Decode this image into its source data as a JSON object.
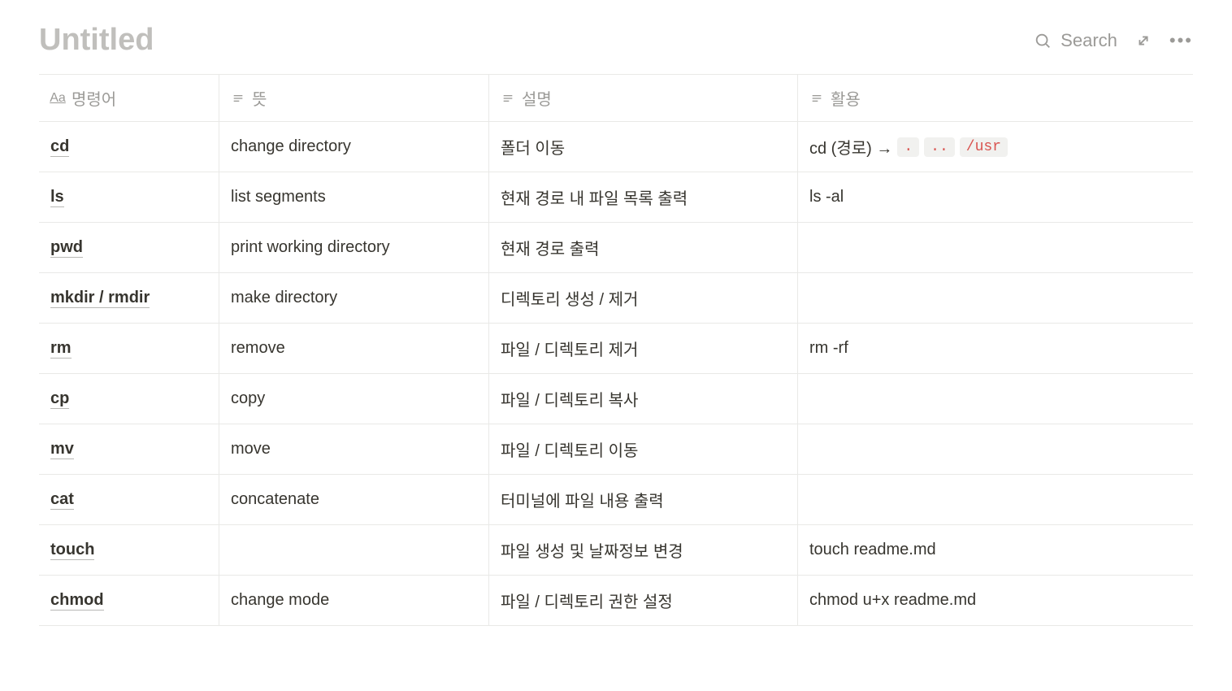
{
  "header": {
    "title": "Untitled",
    "search_label": "Search"
  },
  "table": {
    "columns": [
      {
        "label": "명령어",
        "icon": "aa"
      },
      {
        "label": "뜻",
        "icon": "lines"
      },
      {
        "label": "설명",
        "icon": "lines"
      },
      {
        "label": "활용",
        "icon": "lines"
      }
    ],
    "rows": [
      {
        "command": "cd",
        "meaning": "change directory",
        "description": "폴더 이동",
        "usage_prefix": "cd (경로) → ",
        "usage_chips": [
          ".",
          "..",
          "/usr"
        ]
      },
      {
        "command": "ls",
        "meaning": "list segments",
        "description": "현재 경로 내 파일 목록 출력",
        "usage_text": "ls -al"
      },
      {
        "command": "pwd",
        "meaning": "print working directory",
        "description": "현재 경로 출력",
        "usage_text": ""
      },
      {
        "command": "mkdir / rmdir",
        "meaning": "make directory",
        "description": "디렉토리 생성 / 제거",
        "usage_text": ""
      },
      {
        "command": "rm",
        "meaning": "remove",
        "description": "파일 / 디렉토리 제거",
        "usage_text": "rm -rf"
      },
      {
        "command": "cp",
        "meaning": "copy",
        "description": "파일 / 디렉토리 복사",
        "usage_text": ""
      },
      {
        "command": "mv",
        "meaning": "move",
        "description": "파일 / 디렉토리 이동",
        "usage_text": ""
      },
      {
        "command": "cat",
        "meaning": "concatenate",
        "description": "터미널에 파일 내용 출력",
        "usage_text": ""
      },
      {
        "command": "touch",
        "meaning": "",
        "description": "파일 생성 및 날짜정보 변경",
        "usage_text": "touch readme.md"
      },
      {
        "command": "chmod",
        "meaning": "change mode",
        "description": "파일 / 디렉토리 권한 설정",
        "usage_text": "chmod u+x readme.md"
      }
    ]
  }
}
